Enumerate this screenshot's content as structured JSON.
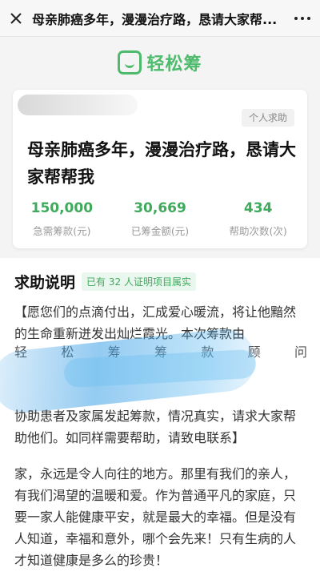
{
  "header": {
    "title": "母亲肺癌多年，漫漫治疗路，恳请大家帮..."
  },
  "brand": {
    "name": "轻松筹"
  },
  "card": {
    "tag": "个人求助",
    "title": "母亲肺癌多年，漫漫治疗路，恳请大家帮帮我",
    "stats": [
      {
        "value": "150,000",
        "label": "急需筹款(元)"
      },
      {
        "value": "30,669",
        "label": "已筹金额(元)"
      },
      {
        "value": "434",
        "label": "帮助次数(次)"
      }
    ]
  },
  "help": {
    "heading": "求助说明",
    "verify_prefix": "已有",
    "verify_count": "32",
    "verify_suffix": "人证明项目属实",
    "para1": "【愿您们的点滴付出，汇成爱心暖流，将让他黯然的生命重新迸发出灿烂霞光。本次筹款由",
    "para1_partial": [
      "轻",
      "松",
      "筹",
      "筹",
      "款",
      "顾",
      "问"
    ],
    "para1_end": "协助患者及家属发起筹款，情况真实，请求大家帮助他们。如同样需要帮助，请致电联系】",
    "para2": "家，永远是令人向往的地方。那里有我们的亲人，有我们渴望的温暖和爱。作为普通平凡的家庭，只要一家人能健康平安，就是最大的幸福。但是没有人知道，幸福和意外，哪个会先来！只有生病的人才知道健康是多么的珍贵！"
  }
}
